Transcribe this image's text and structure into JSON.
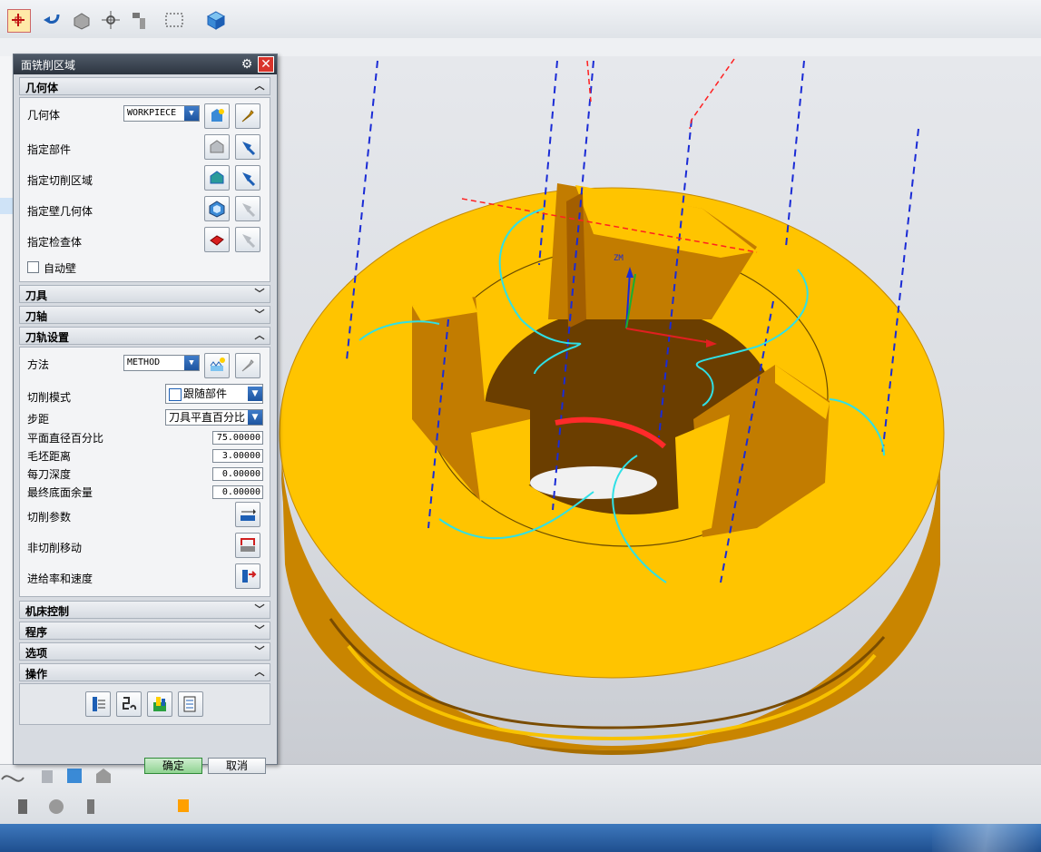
{
  "dialog": {
    "title": "面铣削区域",
    "geometry": {
      "header": "几何体",
      "geometry_label": "几何体",
      "geometry_value": "WORKPIECE",
      "specify_part": "指定部件",
      "specify_cut_area": "指定切削区域",
      "specify_wall_geometry": "指定壁几何体",
      "specify_check_body": "指定检查体",
      "auto_wall": "自动壁"
    },
    "tool_header": "刀具",
    "axis_header": "刀轴",
    "path_settings": {
      "header": "刀轨设置",
      "method_label": "方法",
      "method_value": "METHOD",
      "cut_pattern_label": "切削模式",
      "cut_pattern_value": "跟随部件",
      "stepover_label": "步距",
      "stepover_value": "刀具平直百分比",
      "flat_diameter_pct_label": "平面直径百分比",
      "flat_diameter_pct_value": "75.00000",
      "blank_distance_label": "毛坯距离",
      "blank_distance_value": "3.00000",
      "depth_per_cut_label": "每刀深度",
      "depth_per_cut_value": "0.00000",
      "final_floor_stock_label": "最终底面余量",
      "final_floor_stock_value": "0.00000",
      "cut_params_label": "切削参数",
      "non_cut_moves_label": "非切削移动",
      "feeds_speeds_label": "进给率和速度"
    },
    "machine_control_header": "机床控制",
    "program_header": "程序",
    "options_header": "选项",
    "actions_header": "操作",
    "ok_label": "确定",
    "cancel_label": "取消"
  },
  "viewport": {
    "csys_label": "ZM",
    "part_color": "#f5c400",
    "tool_axis_color": "#1a2bd6",
    "cut_path_color": "#2fe0e6",
    "engage_color": "#ff2a2a"
  },
  "icons": {
    "top_toolbar": [
      "select-feature-icon",
      "undo-icon",
      "part-body-icon",
      "move-icon",
      "tool-icon",
      "box-select-icon",
      "cube-icon"
    ],
    "bottom_toolbar": [
      "curve-icon",
      "datum-icon",
      "box-icon",
      "solid-icon",
      "hole-icon",
      "chain-icon",
      "pattern-icon",
      "union-icon"
    ]
  }
}
